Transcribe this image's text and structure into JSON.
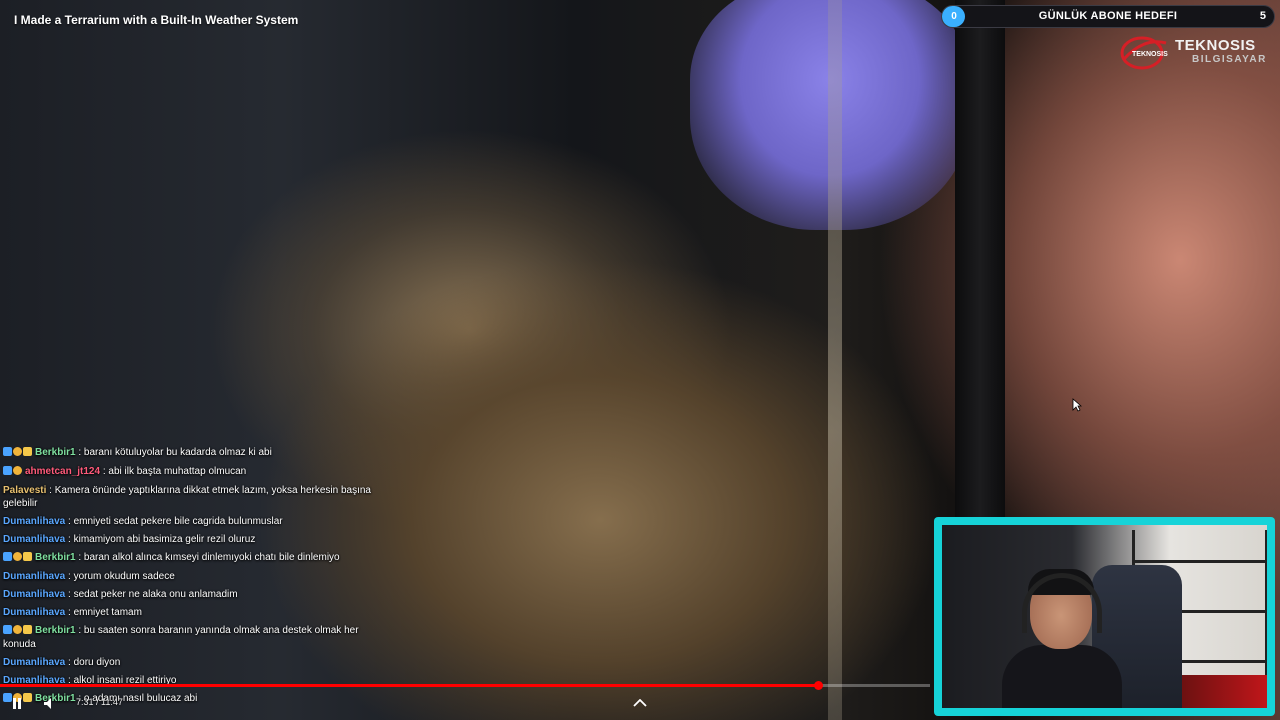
{
  "video": {
    "title": "I Made a Terrarium with a Built-In Weather System",
    "time_label": "7:31 / 11:47",
    "progress_fraction": 0.88
  },
  "goal": {
    "current": "0",
    "label": "GÜNLÜK ABONE HEDEFI",
    "target": "5",
    "fill_fraction": 0.04
  },
  "sponsor": {
    "name": "TEKNOSIS",
    "sub": "BILGISAYAR"
  },
  "chat": {
    "messages": [
      {
        "user": "Berkbir1",
        "user_color": "#7fe0a0",
        "badges": [
          "mod",
          "sub",
          "gift"
        ],
        "text": "baranı kötuluyolar bu kadarda olmaz ki abi"
      },
      {
        "user": "ahmetcan_jt124",
        "user_color": "#ff5a7a",
        "badges": [
          "mod",
          "sub"
        ],
        "text": "abi ilk başta muhattap olmucan"
      },
      {
        "user": "Palavesti",
        "user_color": "#e8c170",
        "badges": [],
        "text": "Kamera önünde yaptıklarına dikkat etmek lazım, yoksa herkesin başına gelebilir"
      },
      {
        "user": "Dumanlihava",
        "user_color": "#5aa7ff",
        "badges": [],
        "text": "emniyeti sedat pekere bile cagrida bulunmuslar"
      },
      {
        "user": "Dumanlihava",
        "user_color": "#5aa7ff",
        "badges": [],
        "text": "kimamiyom abi basimiza gelir rezil oluruz"
      },
      {
        "user": "Berkbir1",
        "user_color": "#7fe0a0",
        "badges": [
          "mod",
          "sub",
          "gift"
        ],
        "text": "baran alkol alınca kımseyi dinlemıyoki chatı bile dinlemiyo"
      },
      {
        "user": "Dumanlihava",
        "user_color": "#5aa7ff",
        "badges": [],
        "text": "yorum okudum sadece"
      },
      {
        "user": "Dumanlihava",
        "user_color": "#5aa7ff",
        "badges": [],
        "text": "sedat peker ne alaka onu anlamadim"
      },
      {
        "user": "Dumanlihava",
        "user_color": "#5aa7ff",
        "badges": [],
        "text": "emniyet tamam"
      },
      {
        "user": "Berkbir1",
        "user_color": "#7fe0a0",
        "badges": [
          "mod",
          "sub",
          "gift"
        ],
        "text": "bu saaten sonra baranın yanında olmak ana destek olmak her konuda"
      },
      {
        "user": "Dumanlihava",
        "user_color": "#5aa7ff",
        "badges": [],
        "text": "doru diyon"
      },
      {
        "user": "Dumanlihava",
        "user_color": "#5aa7ff",
        "badges": [],
        "text": "alkol insani rezil ettiriyo"
      },
      {
        "user": "Berkbir1",
        "user_color": "#7fe0a0",
        "badges": [
          "mod",
          "sub",
          "gift"
        ],
        "text": "o adamı nasıl bulucaz abi"
      }
    ]
  },
  "icons": {
    "pause": "pause-icon",
    "volume": "volume-icon",
    "chevron": "chevron-up-icon",
    "cursor": "mouse-cursor-icon"
  },
  "colors": {
    "webcam_border": "#16d3d8",
    "goal_fill": "#3ab0ff",
    "progress": "#ff0000"
  }
}
